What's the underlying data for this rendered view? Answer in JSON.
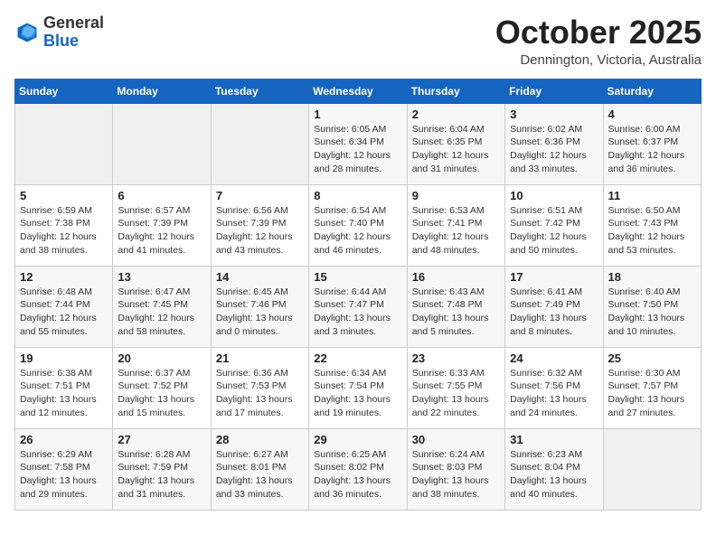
{
  "header": {
    "logo": {
      "general": "General",
      "blue": "Blue"
    },
    "title": "October 2025",
    "location": "Dennington, Victoria, Australia"
  },
  "calendar": {
    "weekdays": [
      "Sunday",
      "Monday",
      "Tuesday",
      "Wednesday",
      "Thursday",
      "Friday",
      "Saturday"
    ],
    "weeks": [
      [
        {
          "day": "",
          "info": ""
        },
        {
          "day": "",
          "info": ""
        },
        {
          "day": "",
          "info": ""
        },
        {
          "day": "1",
          "info": "Sunrise: 6:05 AM\nSunset: 6:34 PM\nDaylight: 12 hours\nand 28 minutes."
        },
        {
          "day": "2",
          "info": "Sunrise: 6:04 AM\nSunset: 6:35 PM\nDaylight: 12 hours\nand 31 minutes."
        },
        {
          "day": "3",
          "info": "Sunrise: 6:02 AM\nSunset: 6:36 PM\nDaylight: 12 hours\nand 33 minutes."
        },
        {
          "day": "4",
          "info": "Sunrise: 6:00 AM\nSunset: 6:37 PM\nDaylight: 12 hours\nand 36 minutes."
        }
      ],
      [
        {
          "day": "5",
          "info": "Sunrise: 6:59 AM\nSunset: 7:38 PM\nDaylight: 12 hours\nand 38 minutes."
        },
        {
          "day": "6",
          "info": "Sunrise: 6:57 AM\nSunset: 7:39 PM\nDaylight: 12 hours\nand 41 minutes."
        },
        {
          "day": "7",
          "info": "Sunrise: 6:56 AM\nSunset: 7:39 PM\nDaylight: 12 hours\nand 43 minutes."
        },
        {
          "day": "8",
          "info": "Sunrise: 6:54 AM\nSunset: 7:40 PM\nDaylight: 12 hours\nand 46 minutes."
        },
        {
          "day": "9",
          "info": "Sunrise: 6:53 AM\nSunset: 7:41 PM\nDaylight: 12 hours\nand 48 minutes."
        },
        {
          "day": "10",
          "info": "Sunrise: 6:51 AM\nSunset: 7:42 PM\nDaylight: 12 hours\nand 50 minutes."
        },
        {
          "day": "11",
          "info": "Sunrise: 6:50 AM\nSunset: 7:43 PM\nDaylight: 12 hours\nand 53 minutes."
        }
      ],
      [
        {
          "day": "12",
          "info": "Sunrise: 6:48 AM\nSunset: 7:44 PM\nDaylight: 12 hours\nand 55 minutes."
        },
        {
          "day": "13",
          "info": "Sunrise: 6:47 AM\nSunset: 7:45 PM\nDaylight: 12 hours\nand 58 minutes."
        },
        {
          "day": "14",
          "info": "Sunrise: 6:45 AM\nSunset: 7:46 PM\nDaylight: 13 hours\nand 0 minutes."
        },
        {
          "day": "15",
          "info": "Sunrise: 6:44 AM\nSunset: 7:47 PM\nDaylight: 13 hours\nand 3 minutes."
        },
        {
          "day": "16",
          "info": "Sunrise: 6:43 AM\nSunset: 7:48 PM\nDaylight: 13 hours\nand 5 minutes."
        },
        {
          "day": "17",
          "info": "Sunrise: 6:41 AM\nSunset: 7:49 PM\nDaylight: 13 hours\nand 8 minutes."
        },
        {
          "day": "18",
          "info": "Sunrise: 6:40 AM\nSunset: 7:50 PM\nDaylight: 13 hours\nand 10 minutes."
        }
      ],
      [
        {
          "day": "19",
          "info": "Sunrise: 6:38 AM\nSunset: 7:51 PM\nDaylight: 13 hours\nand 12 minutes."
        },
        {
          "day": "20",
          "info": "Sunrise: 6:37 AM\nSunset: 7:52 PM\nDaylight: 13 hours\nand 15 minutes."
        },
        {
          "day": "21",
          "info": "Sunrise: 6:36 AM\nSunset: 7:53 PM\nDaylight: 13 hours\nand 17 minutes."
        },
        {
          "day": "22",
          "info": "Sunrise: 6:34 AM\nSunset: 7:54 PM\nDaylight: 13 hours\nand 19 minutes."
        },
        {
          "day": "23",
          "info": "Sunrise: 6:33 AM\nSunset: 7:55 PM\nDaylight: 13 hours\nand 22 minutes."
        },
        {
          "day": "24",
          "info": "Sunrise: 6:32 AM\nSunset: 7:56 PM\nDaylight: 13 hours\nand 24 minutes."
        },
        {
          "day": "25",
          "info": "Sunrise: 6:30 AM\nSunset: 7:57 PM\nDaylight: 13 hours\nand 27 minutes."
        }
      ],
      [
        {
          "day": "26",
          "info": "Sunrise: 6:29 AM\nSunset: 7:58 PM\nDaylight: 13 hours\nand 29 minutes."
        },
        {
          "day": "27",
          "info": "Sunrise: 6:28 AM\nSunset: 7:59 PM\nDaylight: 13 hours\nand 31 minutes."
        },
        {
          "day": "28",
          "info": "Sunrise: 6:27 AM\nSunset: 8:01 PM\nDaylight: 13 hours\nand 33 minutes."
        },
        {
          "day": "29",
          "info": "Sunrise: 6:25 AM\nSunset: 8:02 PM\nDaylight: 13 hours\nand 36 minutes."
        },
        {
          "day": "30",
          "info": "Sunrise: 6:24 AM\nSunset: 8:03 PM\nDaylight: 13 hours\nand 38 minutes."
        },
        {
          "day": "31",
          "info": "Sunrise: 6:23 AM\nSunset: 8:04 PM\nDaylight: 13 hours\nand 40 minutes."
        },
        {
          "day": "",
          "info": ""
        }
      ]
    ]
  }
}
